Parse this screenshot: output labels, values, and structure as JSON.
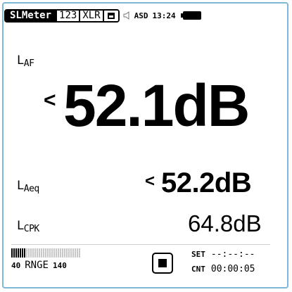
{
  "statusbar": {
    "tabs": [
      {
        "label": "SLMeter",
        "active": true
      },
      {
        "label": "123",
        "active": false
      },
      {
        "label": "XLR",
        "active": false
      }
    ],
    "sd_icon": "sd-card-icon",
    "speaker_icon": "speaker-icon",
    "asd": "ASD",
    "time": "13:24",
    "battery_icon": "battery-icon",
    "battery_level": 1.0
  },
  "primary": {
    "label_main": "L",
    "label_sub": "AF",
    "indicator": "<",
    "value": "52.1dB"
  },
  "secondary": [
    {
      "label_main": "L",
      "label_sub": "Aeq",
      "indicator": "<",
      "value": "52.2dB"
    },
    {
      "label_main": "L",
      "label_sub": "CPK",
      "indicator": "",
      "value": "64.8dB"
    }
  ],
  "range": {
    "low": "40",
    "label": "RNGE",
    "high": "140",
    "level_fraction": 0.2
  },
  "stop_button_icon": "stop-icon",
  "timer": {
    "set_label": "SET",
    "set_value": "--:--:--",
    "cnt_label": "CNT",
    "cnt_value": "00:00:05"
  },
  "colors": {
    "frame": "#7fb8d6",
    "foreground": "#000000",
    "background": "#ffffff"
  }
}
